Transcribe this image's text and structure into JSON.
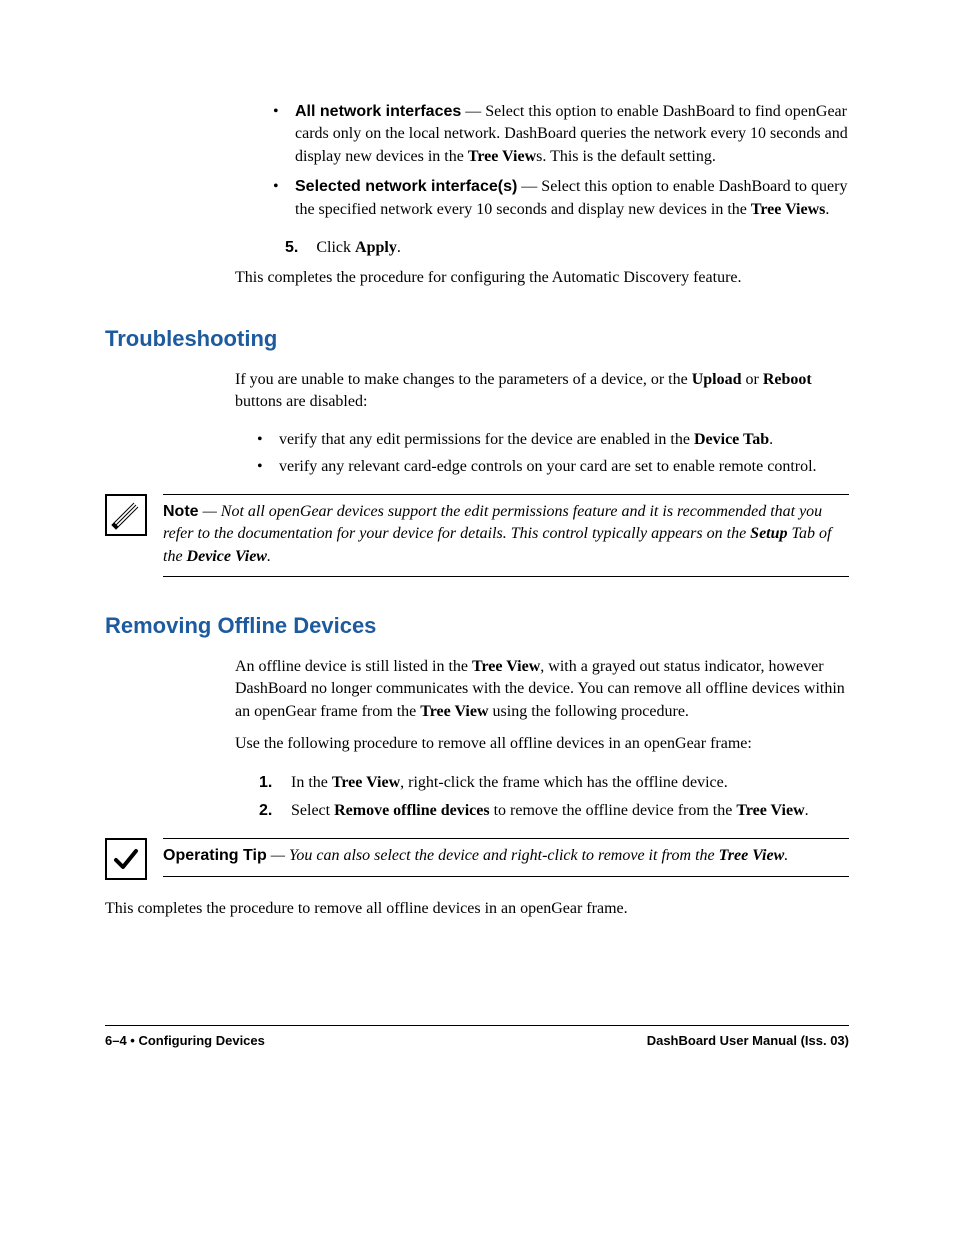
{
  "topBullets": {
    "b1": {
      "label": "All network interfaces",
      "text": " — Select this option to enable DashBoard to find openGear cards only on the local network. DashBoard queries the network every 10 seconds and display new devices in the ",
      "bold1": "Tree View",
      "tail": "s. This is the default setting."
    },
    "b2": {
      "label": "Selected network interface(s)",
      "text": " — Select this option to enable DashBoard to query the specified network every 10 seconds and display new devices in the ",
      "bold1": "Tree Views",
      "tail": "."
    }
  },
  "step5": {
    "num": "5.",
    "pre": "Click ",
    "bold": "Apply",
    "post": "."
  },
  "completes1": "This completes the procedure for configuring the Automatic Discovery feature.",
  "trouble": {
    "heading": "Troubleshooting",
    "intro_pre": "If you are unable to make changes to the parameters of a device, or the ",
    "b1": "Upload",
    "mid": " or ",
    "b2": "Reboot",
    "intro_post": " buttons are disabled:",
    "li1_pre": "verify that any edit permissions for the device are enabled in the ",
    "li1_b": "Device Tab",
    "li1_post": ".",
    "li2": "verify any relevant card-edge controls on your card are set to enable remote control.",
    "note_lead": "Note",
    "note_body1": " — Not all openGear devices support the edit permissions feature and it is recommended that you refer to the documentation for your device for details. This control typically appears on the ",
    "note_b1": "Setup",
    "note_mid": " Tab of the ",
    "note_b2": "Device View",
    "note_post": "."
  },
  "removing": {
    "heading": "Removing Offline Devices",
    "p1_a": "An offline device is still listed in the ",
    "p1_b1": "Tree View",
    "p1_b": ", with a grayed out status indicator, however DashBoard no longer communicates with the device. You can remove all offline devices within an openGear frame from the ",
    "p1_b2": "Tree View",
    "p1_c": " using the following procedure.",
    "p2": "Use the following procedure to remove all offline devices in an openGear frame:",
    "s1_a": "In the ",
    "s1_b": "Tree View",
    "s1_c": ", right-click the frame which has the offline device.",
    "s2_a": "Select ",
    "s2_b": "Remove offline devices",
    "s2_c": " to remove the offline device from the ",
    "s2_d": "Tree View",
    "s2_e": ".",
    "tip_lead": "Operating Tip",
    "tip_a": " — You can also select the device and right-click to remove it from the ",
    "tip_b": "Tree View",
    "tip_c": ".",
    "completes2": "This completes the procedure to remove all offline devices in an openGear frame."
  },
  "footer": {
    "left": "6–4 • Configuring Devices",
    "right": "DashBoard User Manual (Iss. 03)"
  }
}
